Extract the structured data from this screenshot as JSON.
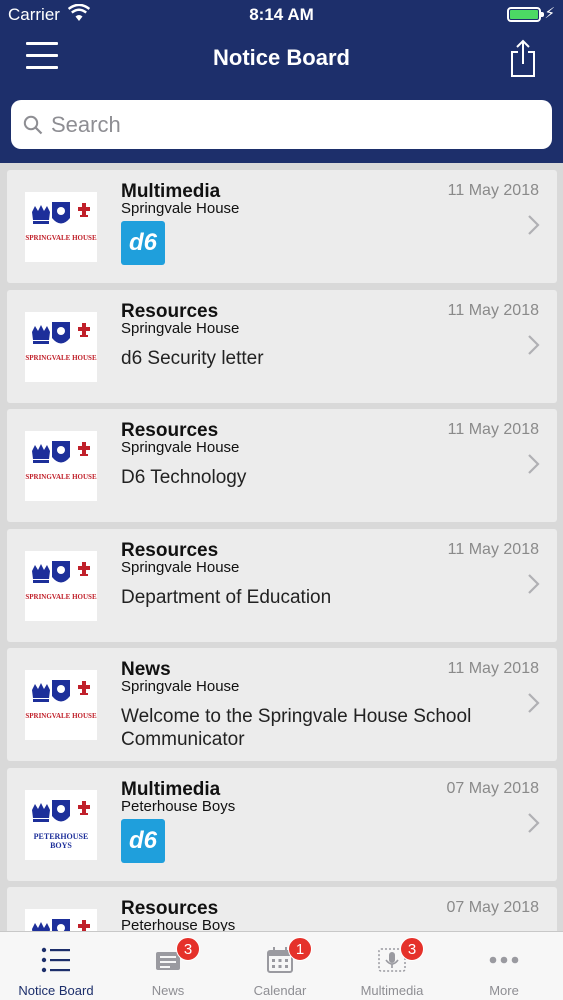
{
  "status_bar": {
    "carrier": "Carrier",
    "time": "8:14 AM"
  },
  "navbar": {
    "title": "Notice Board"
  },
  "search": {
    "placeholder": "Search"
  },
  "notices": [
    {
      "category": "Multimedia",
      "school": "Springvale House",
      "date": "11 May 2018",
      "body": "",
      "badge": "d6",
      "logo_text": "Springvale House"
    },
    {
      "category": "Resources",
      "school": "Springvale House",
      "date": "11 May 2018",
      "body": "d6 Security letter",
      "badge": "",
      "logo_text": "Springvale House"
    },
    {
      "category": "Resources",
      "school": "Springvale House",
      "date": "11 May 2018",
      "body": "D6 Technology",
      "badge": "",
      "logo_text": "Springvale House"
    },
    {
      "category": "Resources",
      "school": "Springvale House",
      "date": "11 May 2018",
      "body": "Department of Education",
      "badge": "",
      "logo_text": "Springvale House"
    },
    {
      "category": "News",
      "school": "Springvale House",
      "date": "11 May 2018",
      "body": "Welcome to the Springvale House  School Communicator",
      "badge": "",
      "logo_text": "Springvale House"
    },
    {
      "category": "Multimedia",
      "school": "Peterhouse Boys",
      "date": "07 May 2018",
      "body": "",
      "badge": "d6",
      "logo_text": "Peterhouse Boys"
    },
    {
      "category": "Resources",
      "school": "Peterhouse Boys",
      "date": "07 May 2018",
      "body": "",
      "badge": "",
      "logo_text": "Peterhouse Boys"
    }
  ],
  "tabs": [
    {
      "label": "Notice Board",
      "badge": ""
    },
    {
      "label": "News",
      "badge": "3"
    },
    {
      "label": "Calendar",
      "badge": "1"
    },
    {
      "label": "Multimedia",
      "badge": "3"
    },
    {
      "label": "More",
      "badge": ""
    }
  ],
  "colors": {
    "header": "#1d2f6b",
    "badge": "#e5312a",
    "d6": "#1f9fdc",
    "battery": "#4cd964"
  }
}
